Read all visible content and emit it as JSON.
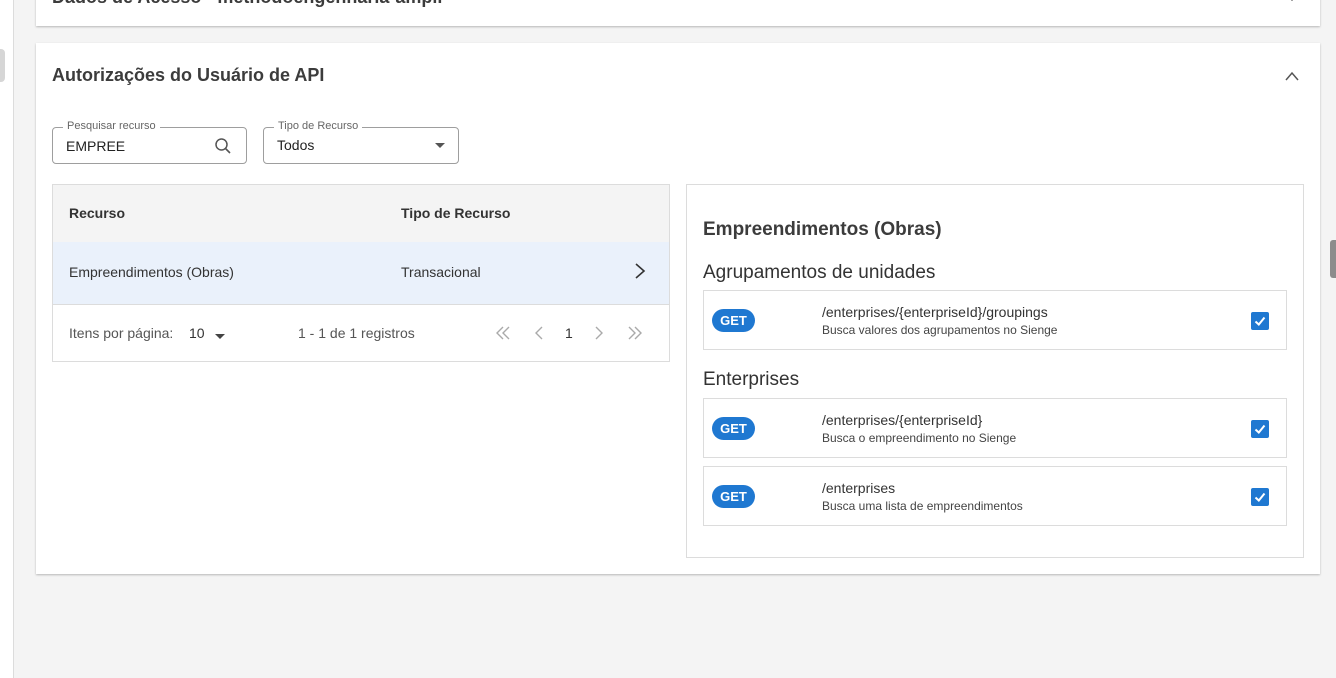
{
  "sections": {
    "access_title": "Dados de Acesso - methodoengenharia-ampli",
    "api_title": "Autorizações do Usuário de API"
  },
  "search": {
    "label": "Pesquisar recurso",
    "value": "EMPREE",
    "icon": "search-icon"
  },
  "type_filter": {
    "label": "Tipo de Recurso",
    "value": "Todos"
  },
  "table": {
    "headers": [
      "Recurso",
      "Tipo de Recurso"
    ],
    "rows": [
      {
        "resource": "Empreendimentos (Obras)",
        "type": "Transacional"
      }
    ]
  },
  "pagination": {
    "items_label": "Itens por página:",
    "page_size": "10",
    "range_text": "1 - 1 de 1 registros",
    "current_page": "1"
  },
  "detail": {
    "title": "Empreendimentos (Obras)",
    "groups": [
      {
        "name": "Agrupamentos de unidades",
        "endpoints": [
          {
            "method": "GET",
            "path": "/enterprises/{enterpriseId}/groupings",
            "description": "Busca valores dos agrupamentos no Sienge",
            "checked": true
          }
        ]
      },
      {
        "name": "Enterprises",
        "endpoints": [
          {
            "method": "GET",
            "path": "/enterprises/{enterpriseId}",
            "description": "Busca o empreendimento no Sienge",
            "checked": true
          },
          {
            "method": "GET",
            "path": "/enterprises",
            "description": "Busca uma lista de empreendimentos",
            "checked": true
          }
        ]
      }
    ]
  },
  "colors": {
    "accent": "#1f78d1",
    "selected_row": "#eaf1fb",
    "page_bg": "#f4f4f4"
  }
}
